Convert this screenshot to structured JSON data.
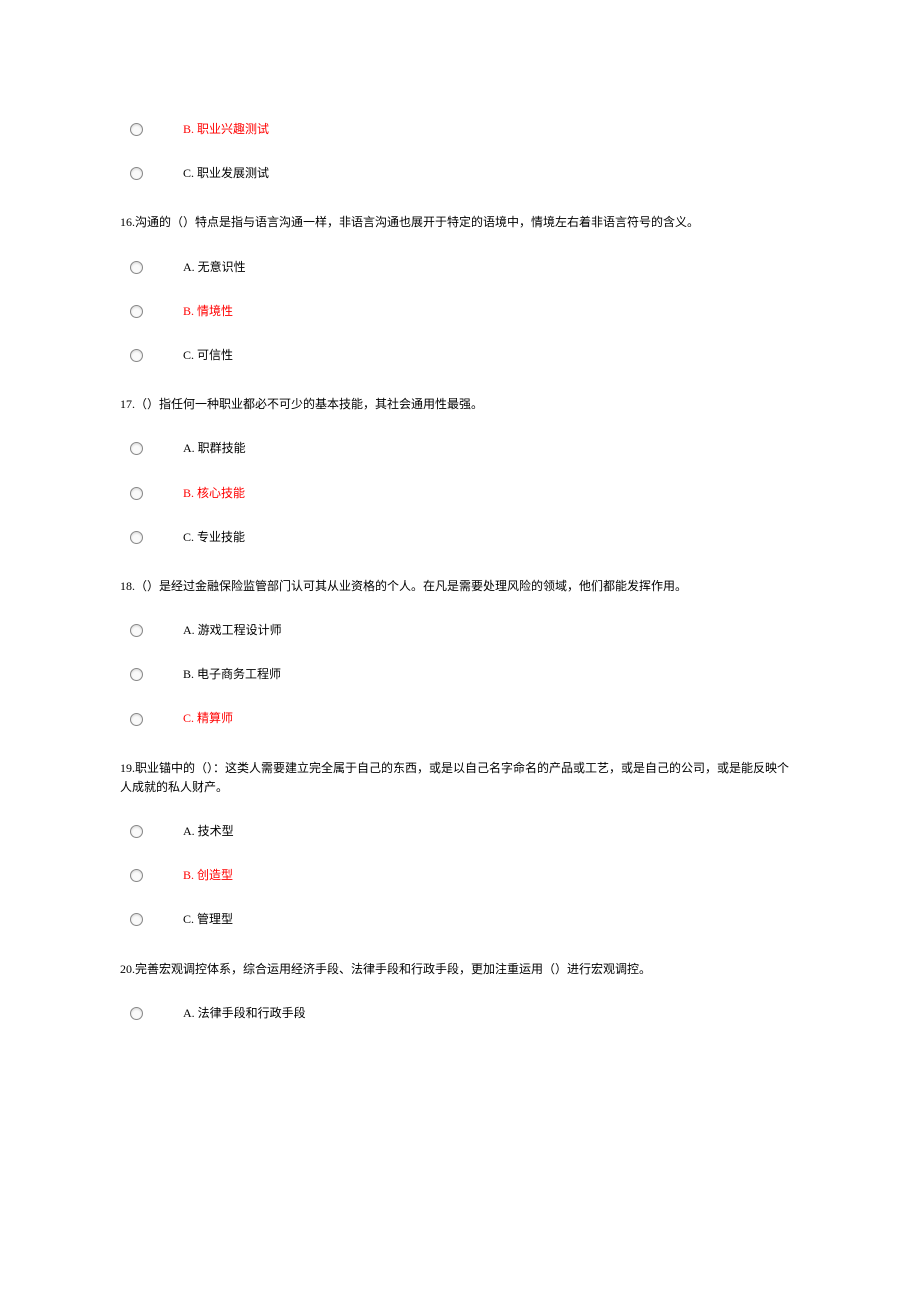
{
  "questions": [
    {
      "number": "",
      "text": "",
      "options": [
        {
          "label": "B. 职业兴趣测试",
          "correct": true
        },
        {
          "label": "C. 职业发展测试",
          "correct": false
        }
      ]
    },
    {
      "number": "16",
      "text": "16.沟通的（）特点是指与语言沟通一样，非语言沟通也展开于特定的语境中，情境左右着非语言符号的含义。",
      "options": [
        {
          "label": "A. 无意识性",
          "correct": false
        },
        {
          "label": "B. 情境性",
          "correct": true
        },
        {
          "label": "C. 可信性",
          "correct": false
        }
      ]
    },
    {
      "number": "17",
      "text": "17.（）指任何一种职业都必不可少的基本技能，其社会通用性最强。",
      "options": [
        {
          "label": "A. 职群技能",
          "correct": false
        },
        {
          "label": "B. 核心技能",
          "correct": true
        },
        {
          "label": "C. 专业技能",
          "correct": false
        }
      ]
    },
    {
      "number": "18",
      "text": "18.（）是经过金融保险监管部门认可其从业资格的个人。在凡是需要处理风险的领域，他们都能发挥作用。",
      "options": [
        {
          "label": "A. 游戏工程设计师",
          "correct": false
        },
        {
          "label": "B. 电子商务工程师",
          "correct": false
        },
        {
          "label": "C. 精算师",
          "correct": true
        }
      ]
    },
    {
      "number": "19",
      "text": "19.职业锚中的（）：这类人需要建立完全属于自己的东西，或是以自己名字命名的产品或工艺，或是自己的公司，或是能反映个人成就的私人财产。",
      "options": [
        {
          "label": "A. 技术型",
          "correct": false
        },
        {
          "label": "B. 创造型",
          "correct": true
        },
        {
          "label": "C. 管理型",
          "correct": false
        }
      ]
    },
    {
      "number": "20",
      "text": "20.完善宏观调控体系，综合运用经济手段、法律手段和行政手段，更加注重运用（）进行宏观调控。",
      "options": [
        {
          "label": "A. 法律手段和行政手段",
          "correct": false
        }
      ]
    }
  ]
}
